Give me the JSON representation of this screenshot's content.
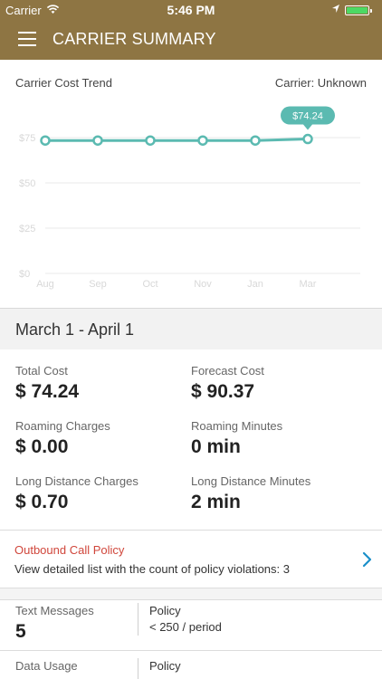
{
  "status_bar": {
    "carrier": "Carrier",
    "wifi_icon": "wifi-icon",
    "time": "5:46 PM",
    "location_icon": "location-arrow-icon",
    "battery_level": 1.0,
    "battery_color": "#4cd964"
  },
  "nav": {
    "menu_icon": "hamburger-menu-icon",
    "title": "CARRIER SUMMARY",
    "background": "#8e7543"
  },
  "chart_card": {
    "title": "Carrier Cost Trend",
    "carrier_label": "Carrier: Unknown"
  },
  "chart_data": {
    "type": "line",
    "title": "Carrier Cost Trend",
    "x": [
      "Aug",
      "Sep",
      "Oct",
      "Nov",
      "Jan",
      "Mar"
    ],
    "series": [
      {
        "values": [
          73.4,
          73.4,
          73.4,
          73.4,
          73.4,
          74.24
        ]
      }
    ],
    "y_ticks": [
      "$0",
      "$25",
      "$50",
      "$75"
    ],
    "ylim": [
      0,
      100
    ],
    "annotation": {
      "index": 5,
      "label": "$74.24"
    },
    "grid": true,
    "line_color": "#5bbab1"
  },
  "period": {
    "label": "March 1 - April 1"
  },
  "stats": {
    "total_cost_label": "Total Cost",
    "total_cost_value": "$ 74.24",
    "forecast_cost_label": "Forecast Cost",
    "forecast_cost_value": "$ 90.37",
    "roaming_charges_label": "Roaming Charges",
    "roaming_charges_value": "$ 0.00",
    "roaming_minutes_label": "Roaming Minutes",
    "roaming_minutes_value": "0 min",
    "long_distance_charges_label": "Long Distance Charges",
    "long_distance_charges_value": "$ 0.70",
    "long_distance_minutes_label": "Long Distance Minutes",
    "long_distance_minutes_value": "2 min"
  },
  "policy": {
    "title": "Outbound Call Policy",
    "description": "View detailed list with the count of policy violations: 3",
    "chevron_icon": "chevron-right-icon",
    "title_color": "#d0463b",
    "chevron_color": "#1a8fc9"
  },
  "usage": {
    "text_messages_label": "Text Messages",
    "text_messages_value": "5",
    "text_policy_label": "Policy",
    "text_policy_value": "< 250 / period",
    "data_usage_label": "Data Usage",
    "data_policy_label": "Policy"
  }
}
